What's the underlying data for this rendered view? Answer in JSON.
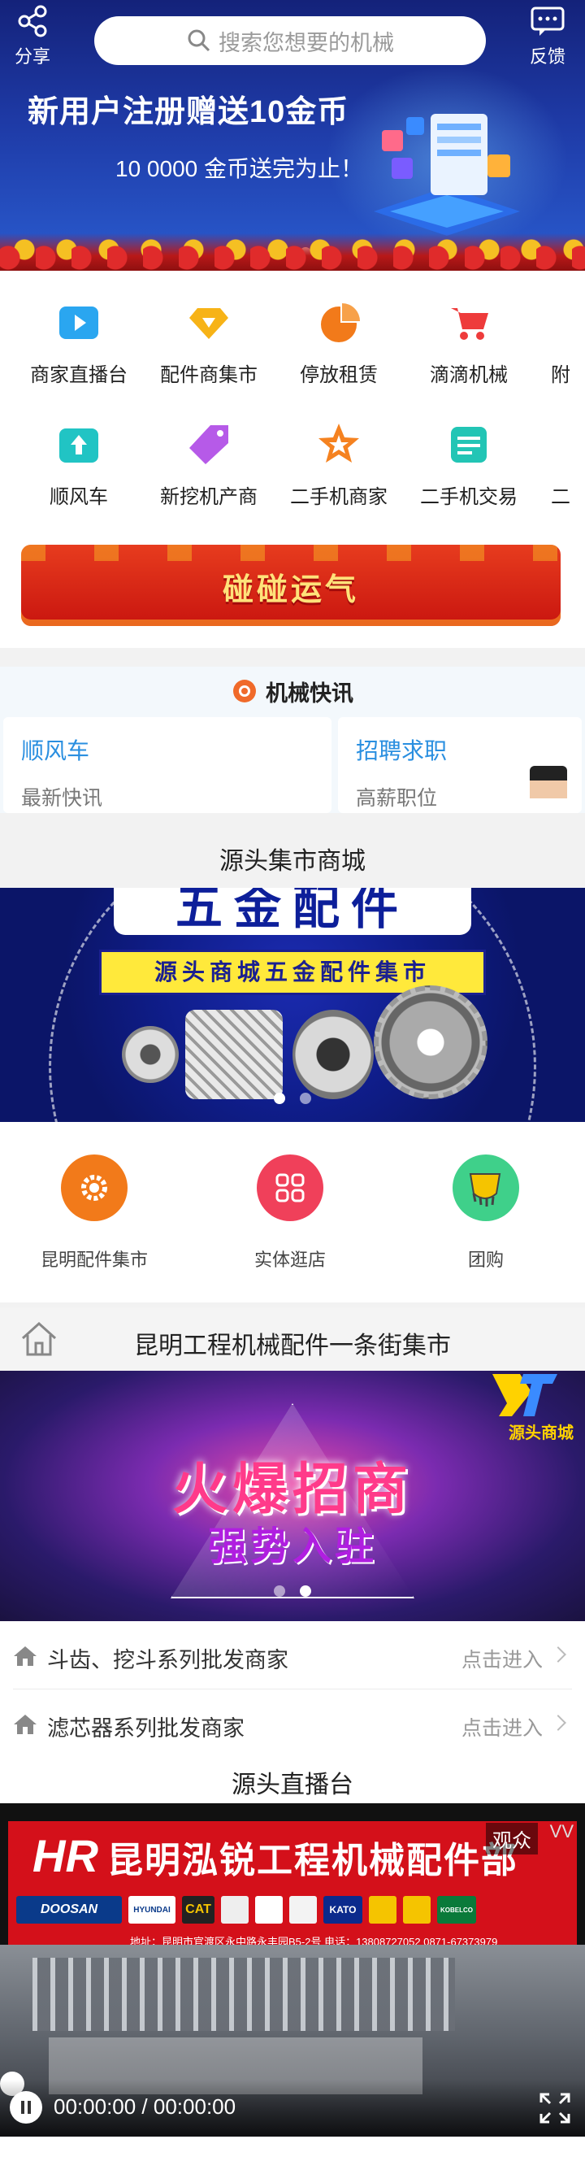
{
  "topbar": {
    "share_label": "分享",
    "search_placeholder": "搜索您想要的机械",
    "feedback_label": "反馈"
  },
  "hero": {
    "title": "新用户注册赠送10金币",
    "subtitle": "10 0000 金币送完为止！",
    "slides": 2,
    "active_slide": 2
  },
  "categories": {
    "row1": [
      {
        "label": "商家直播台",
        "icon": "play-video-icon",
        "color": "#2aa6f0"
      },
      {
        "label": "配件商集市",
        "icon": "diamond-icon",
        "color": "#f7b317"
      },
      {
        "label": "停放租赁",
        "icon": "pie-chart-icon",
        "color": "#f27a1a"
      },
      {
        "label": "滴滴机械",
        "icon": "cart-icon",
        "color": "#ee3b3b"
      },
      {
        "label": "附"
      }
    ],
    "row2": [
      {
        "label": "顺风车",
        "icon": "upload-box-icon",
        "color": "#21c4c4"
      },
      {
        "label": "新挖机产商",
        "icon": "tag-icon",
        "color": "#b65ae8"
      },
      {
        "label": "二手机商家",
        "icon": "star-badge-icon",
        "color": "#f58220"
      },
      {
        "label": "二手机交易",
        "icon": "document-icon",
        "color": "#22c5b5"
      },
      {
        "label": "二"
      }
    ],
    "lucky_banner": "碰碰运气"
  },
  "news": {
    "title": "机械快讯",
    "cards": [
      {
        "title": "顺风车",
        "subtitle": "最新快讯"
      },
      {
        "title": "招聘求职",
        "subtitle": "高薪职位"
      }
    ]
  },
  "mall": {
    "title": "源头集市商城",
    "banner_heading": "五金配件",
    "banner_strip": "源头商城五金配件集市",
    "slides": 2,
    "active_slide": 1,
    "items": [
      {
        "label": "昆明配件集市",
        "icon": "gear-icon",
        "color": "#f27a1a"
      },
      {
        "label": "实体逛店",
        "icon": "grid-icon",
        "color": "#f0405a"
      },
      {
        "label": "团购",
        "icon": "bucket-icon",
        "color": "#3fd08a"
      }
    ]
  },
  "street": {
    "title": "昆明工程机械配件一条街集市",
    "promo_title": "火爆招商",
    "promo_sub": "强势入驻",
    "promo_logo": "源头商城",
    "slides": 2,
    "active_slide": 2,
    "rows": [
      {
        "label": "斗齿、挖斗系列批发商家",
        "action": "点击进入"
      },
      {
        "label": "滤芯器系列批发商家",
        "action": "点击进入"
      }
    ]
  },
  "live": {
    "title": "源头直播台",
    "shop_name": "昆明泓锐工程机械配件部",
    "shop_logo": "HR",
    "brands": [
      "DOOSAN",
      "HYUNDAI",
      "CAT",
      "KATO",
      "KOBELCO"
    ],
    "address": "地址：昆明市官渡区永中路永丰园B5-2号  电话：13808727052  0871-67373979",
    "watch_label": "观众",
    "corner_label": "VV",
    "time_display": "00:00:00 / 00:00:00"
  }
}
